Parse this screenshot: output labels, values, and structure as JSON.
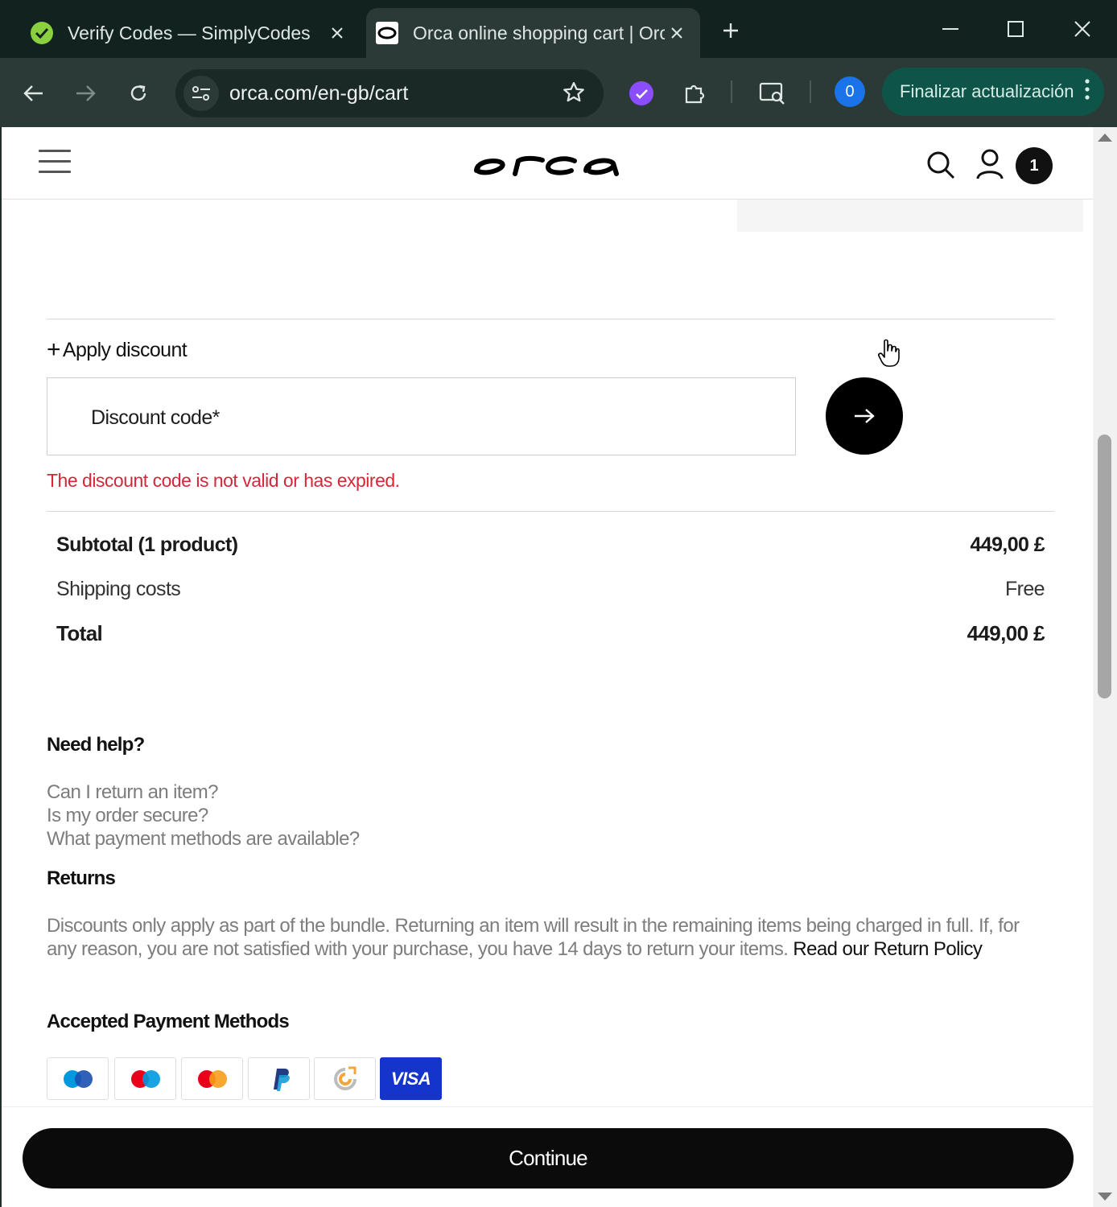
{
  "browser": {
    "tabs": [
      {
        "title": "Verify Codes — SimplyCodes",
        "favicon": "simplycodes-icon"
      },
      {
        "title": "Orca online shopping cart | Orca",
        "favicon": "orca-icon"
      }
    ],
    "url": "orca.com/en-gb/cart",
    "profile_count": "0",
    "update_label": "Finalizar actualización"
  },
  "header": {
    "cart_count": "1"
  },
  "discount": {
    "toggle_label": "Apply discount",
    "placeholder": "Discount code*",
    "error": "The discount code is not valid or has expired."
  },
  "summary": {
    "subtotal_label": "Subtotal (1 product)",
    "subtotal_value": "449,00 £",
    "shipping_label": "Shipping costs",
    "shipping_value": "Free",
    "total_label": "Total",
    "total_value": "449,00 £"
  },
  "help": {
    "title": "Need help?",
    "faqs": [
      "Can I return an item?",
      "Is my order secure?",
      "What payment methods are available?"
    ],
    "returns_title": "Returns",
    "returns_text": "Discounts only apply as part of the bundle. Returning an item will result in the remaining items being charged in full. If, for any reason, you are not satisfied with your purchase, you have 14 days to return your items.",
    "returns_link": "Read our Return Policy",
    "payment_title": "Accepted Payment Methods",
    "payment_methods": [
      "maestro",
      "maestro",
      "mastercard",
      "paypal",
      "google-pay",
      "visa"
    ],
    "visa_label": "VISA"
  },
  "cta": {
    "continue_label": "Continue"
  },
  "colors": {
    "error": "#d6273a",
    "browser_frame": "#12221f",
    "update_button": "#0f5448",
    "visa": "#1434cb"
  }
}
